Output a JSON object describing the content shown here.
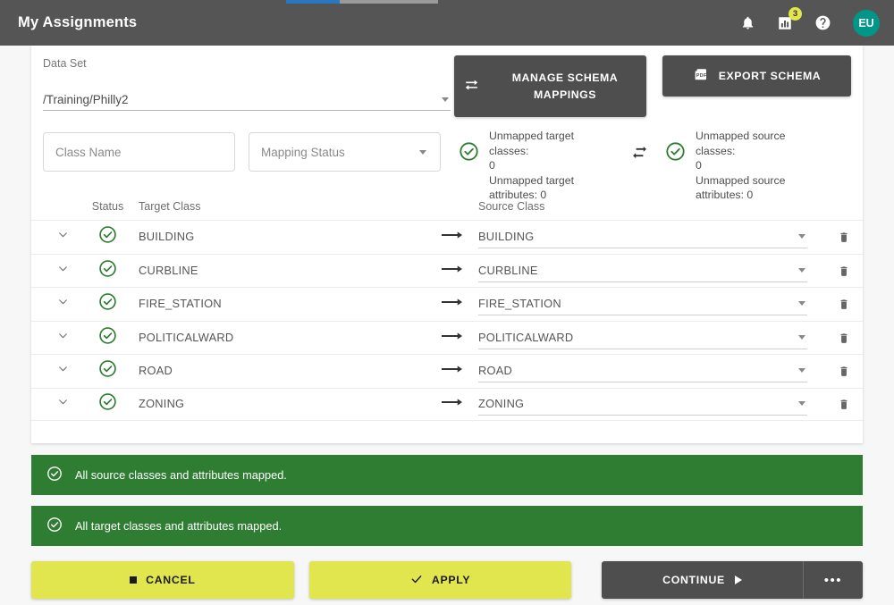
{
  "header": {
    "title": "My Assignments",
    "icons": {
      "notifications": "bell-icon",
      "reports": "chart-icon",
      "help": "help-icon"
    },
    "reports_badge": "3",
    "avatar_initials": "EU"
  },
  "form": {
    "dataset_label": "Data Set",
    "dataset_value": "/Training/Philly2",
    "class_name_placeholder": "Class Name",
    "mapping_status_placeholder": "Mapping Status"
  },
  "toolbar": {
    "manage_schema_label": "MANAGE SCHEMA MAPPINGS",
    "manage_schema_icon": "swap-horizontal-icon",
    "export_schema_label": "EXPORT SCHEMA",
    "export_schema_icon": "pdf-export-icon"
  },
  "summary": {
    "target": {
      "line1": "Unmapped target classes:",
      "line2": "0",
      "line3": "Unmapped target",
      "line4": "attributes: 0",
      "status_icon": "check-circle-icon"
    },
    "swap_icon": "swap-vertical-arrows-icon",
    "source": {
      "line1": "Unmapped source classes:",
      "line2": "0",
      "line3": "Unmapped source",
      "line4": "attributes: 0",
      "status_icon": "check-circle-icon"
    }
  },
  "table": {
    "headers": {
      "status": "Status",
      "target_class": "Target Class",
      "source_class": "Source Class"
    },
    "rows": [
      {
        "target": "BUILDING",
        "source": "BUILDING",
        "status": "mapped"
      },
      {
        "target": "CURBLINE",
        "source": "CURBLINE",
        "status": "mapped"
      },
      {
        "target": "FIRE_STATION",
        "source": "FIRE_STATION",
        "status": "mapped"
      },
      {
        "target": "POLITICALWARD",
        "source": "POLITICALWARD",
        "status": "mapped"
      },
      {
        "target": "ROAD",
        "source": "ROAD",
        "status": "mapped"
      },
      {
        "target": "ZONING",
        "source": "ZONING",
        "status": "mapped"
      }
    ]
  },
  "banners": {
    "source_text": "All source classes and attributes mapped.",
    "target_text": "All target classes and attributes mapped.",
    "color": "#2e7d32"
  },
  "actions": {
    "cancel_label": "CANCEL",
    "apply_label": "APPLY",
    "continue_label": "CONTINUE",
    "more_label": "•••"
  },
  "colors": {
    "appbar": "#555555",
    "accent_yellow": "#e1e64f",
    "success_green": "#2e7d32",
    "avatar_teal": "#009688",
    "progress_blue": "#2a78c2"
  }
}
